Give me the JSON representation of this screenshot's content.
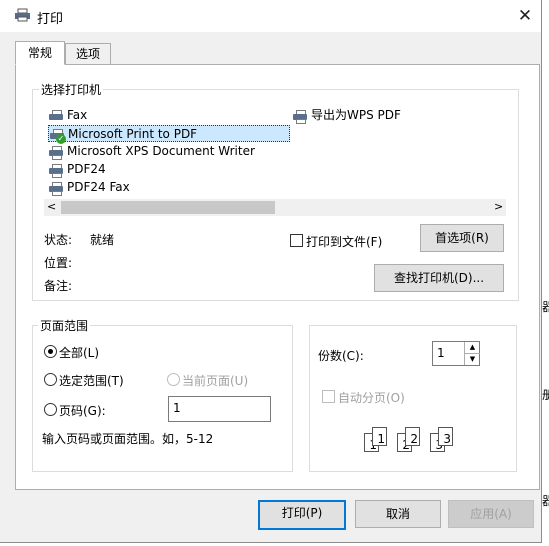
{
  "window": {
    "title": "打印"
  },
  "tabs": [
    {
      "label": "常规"
    },
    {
      "label": "选项"
    }
  ],
  "printer_group": {
    "title": "选择打印机",
    "printers_col1": [
      {
        "name": "Fax"
      },
      {
        "name": "Microsoft Print to PDF",
        "selected": true,
        "default": true
      },
      {
        "name": "Microsoft XPS Document Writer"
      },
      {
        "name": "PDF24"
      },
      {
        "name": "PDF24 Fax"
      }
    ],
    "printers_col2": [
      {
        "name": "导出为WPS PDF"
      }
    ],
    "status_label": "状态:",
    "status_value": "就绪",
    "location_label": "位置:",
    "comment_label": "备注:",
    "print_to_file_label": "打印到文件(F)",
    "preferences_button": "首选项(R)",
    "find_printer_button": "查找打印机(D)..."
  },
  "page_range": {
    "title": "页面范围",
    "all_label": "全部(L)",
    "selection_label": "选定范围(T)",
    "current_page_label": "当前页面(U)",
    "pages_label": "页码(G):",
    "pages_value": "1",
    "hint": "输入页码或页面范围。如，5-12"
  },
  "copies": {
    "label": "份数(C):",
    "value": "1",
    "collate_label": "自动分页(O)",
    "collate_pages": [
      "1",
      "1",
      "2",
      "2",
      "3",
      "3"
    ]
  },
  "buttons": {
    "print": "打印(P)",
    "cancel": "取消",
    "apply": "应用(A)"
  },
  "background_fragments": [
    "器",
    "册",
    "器"
  ],
  "icons": {
    "title": "printer-icon",
    "close": "close-icon",
    "scroll_left": "chevron-left-icon",
    "scroll_right": "chevron-right-icon",
    "spin_up": "triangle-up-icon",
    "spin_down": "triangle-down-icon"
  },
  "colors": {
    "selection_bg": "#cce8ff",
    "default_button_border": "#0078d7"
  }
}
